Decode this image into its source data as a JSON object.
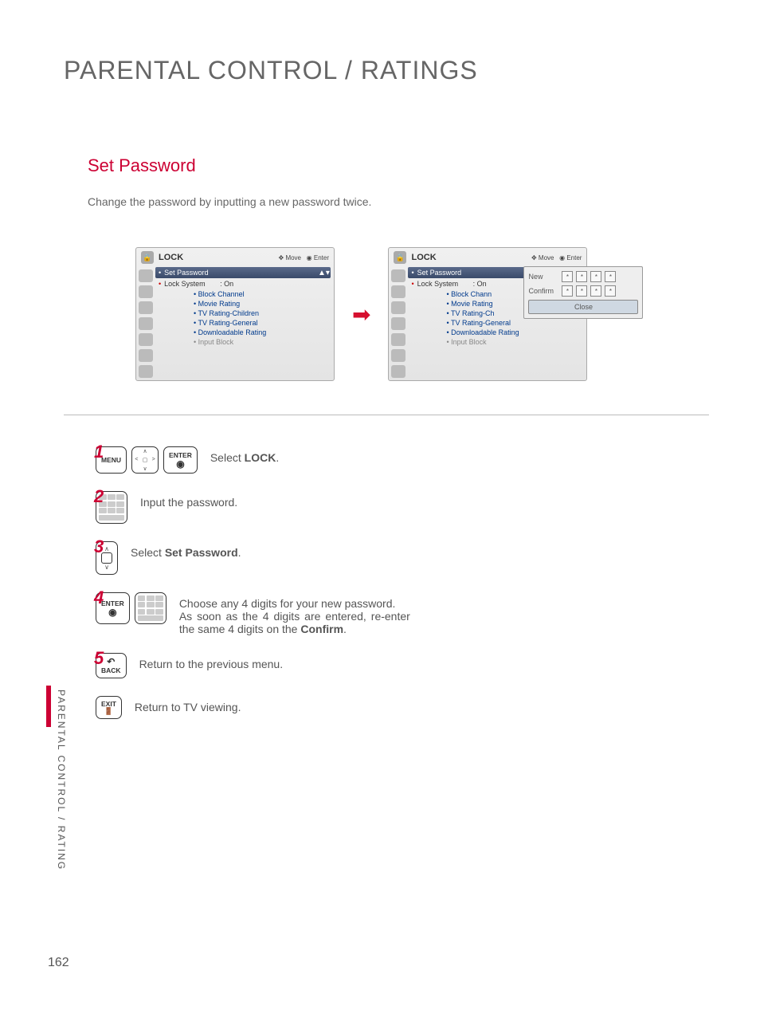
{
  "page": {
    "title": "PARENTAL CONTROL / RATINGS",
    "section_title": "Set Password",
    "section_desc": "Change the password by inputting a new password twice.",
    "side_tab": "PARENTAL CONTROL / RATING",
    "page_number": "162"
  },
  "osd": {
    "title": "LOCK",
    "hint_move": "Move",
    "hint_enter": "Enter",
    "rows": {
      "set_password": "Set Password",
      "lock_system": "Lock System",
      "lock_value": ": On",
      "block_channel": "• Block Channel",
      "movie_rating": "• Movie Rating",
      "tv_children": "• TV Rating-Children",
      "tv_general": "• TV Rating-General",
      "downloadable": "• Downloadable Rating",
      "input_block": "• Input Block"
    },
    "rows2": {
      "block_channel": "• Block Chann",
      "movie_rating": "• Movie Rating",
      "tv_children": "• TV Rating-Ch"
    },
    "popup": {
      "new": "New",
      "confirm": "Confirm",
      "mask": "*",
      "close": "Close"
    }
  },
  "steps": {
    "s1_num": "1",
    "s1_btn_menu": "MENU",
    "s1_btn_enter": "ENTER",
    "s1_text_a": "Select ",
    "s1_text_b": "LOCK",
    "s1_text_c": ".",
    "s2_num": "2",
    "s2_text": "Input the password.",
    "s3_num": "3",
    "s3_text_a": "Select ",
    "s3_text_b": "Set Password",
    "s3_text_c": ".",
    "s4_num": "4",
    "s4_btn_enter": "ENTER",
    "s4_text_a": "Choose any 4 digits for your new password.",
    "s4_text_b": "As soon as the 4 digits are entered, re-enter the same 4 digits on the ",
    "s4_text_c": "Confirm",
    "s4_text_d": ".",
    "s5_num": "5",
    "s5_btn_back": "BACK",
    "s5_text": "Return to the previous menu.",
    "s6_btn_exit": "EXIT",
    "s6_text": "Return to TV viewing."
  }
}
